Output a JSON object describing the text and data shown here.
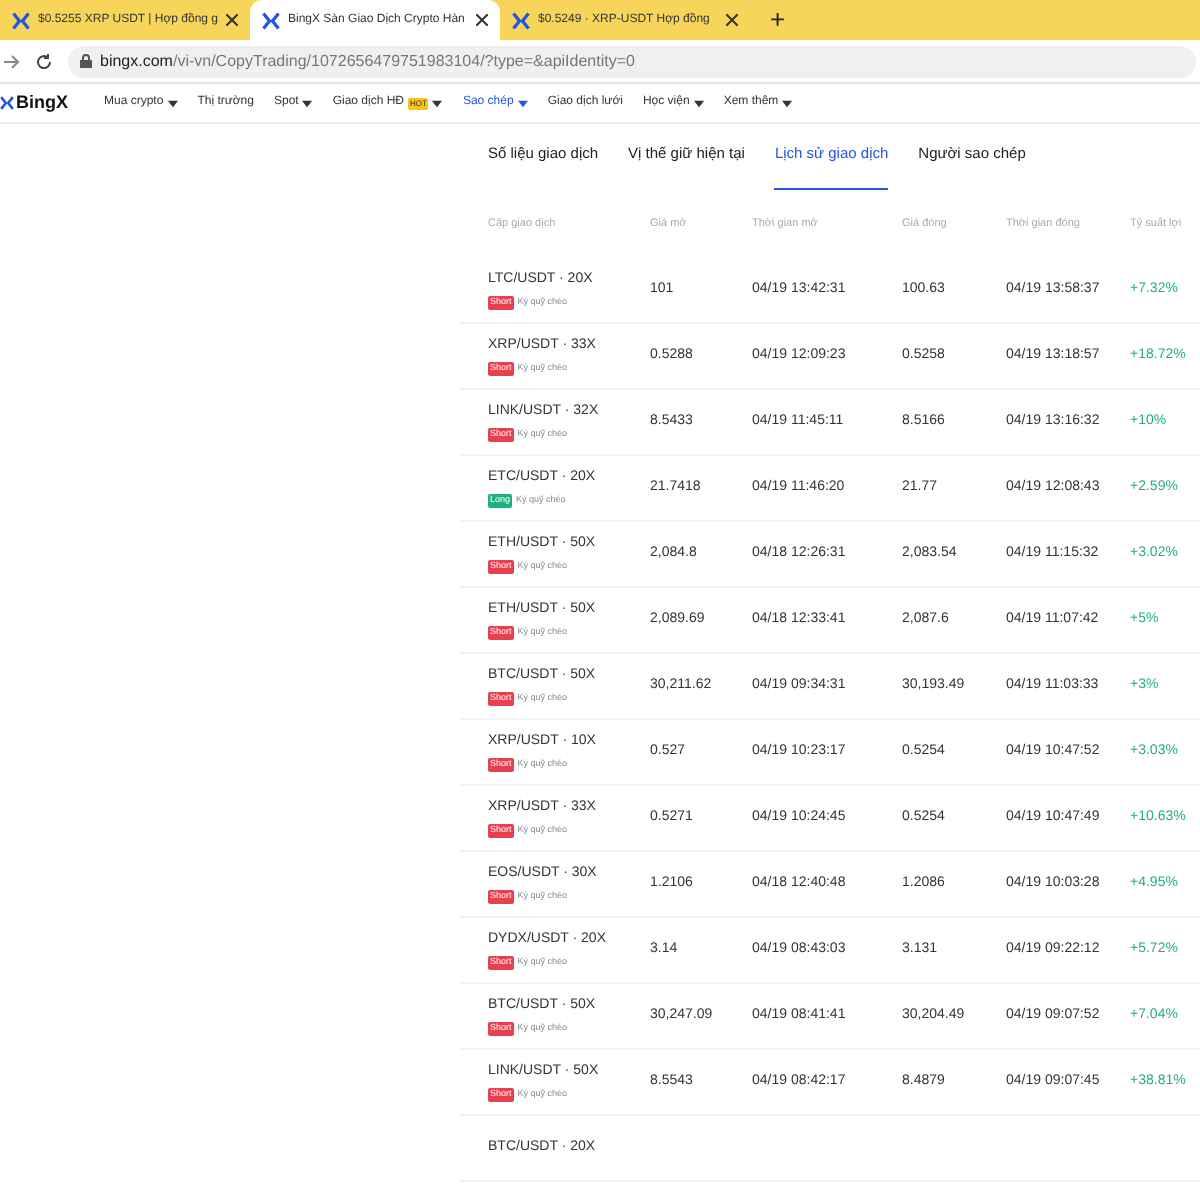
{
  "browser_tabs": [
    {
      "title": "$0.5255 XRP USDT | Hợp đồng g",
      "selected": false
    },
    {
      "title": "BingX Sàn Giao Dịch Crypto Hàn",
      "selected": true
    },
    {
      "title": "$0.5249 · XRP-USDT Hợp đồng",
      "selected": false
    }
  ],
  "new_tab": "+",
  "address_bar": {
    "domain": "bingx.com",
    "path": "/vi-vn/CopyTrading/1072656479751983104/?type=&apiIdentity=0"
  },
  "logo": "BingX",
  "nav": [
    {
      "label": "Mua crypto",
      "dropdown": true,
      "selected": false
    },
    {
      "label": "Thị trường",
      "dropdown": false,
      "selected": false
    },
    {
      "label": "Spot",
      "dropdown": true,
      "selected": false
    },
    {
      "label": "Giao dịch HĐ",
      "badge": "HOT",
      "dropdown": true,
      "selected": false
    },
    {
      "label": "Sao chép",
      "dropdown": true,
      "selected": true
    },
    {
      "label": "Giao dịch lưới",
      "dropdown": false,
      "selected": false
    },
    {
      "label": "Học viện",
      "dropdown": true,
      "selected": false
    },
    {
      "label": "Xem thêm",
      "dropdown": true,
      "selected": false
    }
  ],
  "tabs": [
    {
      "label": "Số liệu giao dịch",
      "selected": false
    },
    {
      "label": "Vị thế giữ hiện tại",
      "selected": false
    },
    {
      "label": "Lịch sử giao dịch",
      "selected": true
    },
    {
      "label": "Người sao chép",
      "selected": false
    }
  ],
  "table": {
    "columns": [
      "Cặp giao dịch",
      "Giá mở",
      "Thời gian mở",
      "Giá đóng",
      "Thời gian đóng",
      "Tỷ suất lợi"
    ],
    "rows": [
      {
        "pair": "LTC/USDT · 20X",
        "kind": "short",
        "side_label": "Short",
        "margin": "Ký quỹ chéo",
        "open_price": "101",
        "open_time": "04/19 13:42:31",
        "close_price": "100.63",
        "close_time": "04/19 13:58:37",
        "roi": "+7.32%"
      },
      {
        "pair": "XRP/USDT · 33X",
        "kind": "short",
        "side_label": "Short",
        "margin": "Ký quỹ chéo",
        "open_price": "0.5288",
        "open_time": "04/19 12:09:23",
        "close_price": "0.5258",
        "close_time": "04/19 13:18:57",
        "roi": "+18.72%"
      },
      {
        "pair": "LINK/USDT · 32X",
        "kind": "short",
        "side_label": "Short",
        "margin": "Ký quỹ chéo",
        "open_price": "8.5433",
        "open_time": "04/19 11:45:11",
        "close_price": "8.5166",
        "close_time": "04/19 13:16:32",
        "roi": "+10%"
      },
      {
        "pair": "ETC/USDT · 20X",
        "kind": "long",
        "side_label": "Long",
        "margin": "Ký quỹ chéo",
        "open_price": "21.7418",
        "open_time": "04/19 11:46:20",
        "close_price": "21.77",
        "close_time": "04/19 12:08:43",
        "roi": "+2.59%"
      },
      {
        "pair": "ETH/USDT · 50X",
        "side_label": "Short",
        "margin": "Ký quỹ chéo",
        "open_price": "2,084.8",
        "kind": "short",
        "open_time": "04/18 12:26:31",
        "close_price": "2,083.54",
        "close_time": "04/19 11:15:32",
        "roi": "+3.02%"
      },
      {
        "pair": "ETH/USDT · 50X",
        "kind": "short",
        "side_label": "Short",
        "margin": "Ký quỹ chéo",
        "open_price": "2,089.69",
        "open_time": "04/18 12:33:41",
        "close_price": "2,087.6",
        "close_time": "04/19 11:07:42",
        "roi": "+5%"
      },
      {
        "pair": "BTC/USDT · 50X",
        "kind": "short",
        "side_label": "Short",
        "margin": "Ký quỹ chéo",
        "open_price": "30,211.62",
        "open_time": "04/19 09:34:31",
        "close_price": "30,193.49",
        "close_time": "04/19 11:03:33",
        "roi": "+3%"
      },
      {
        "pair": "XRP/USDT · 10X",
        "kind": "short",
        "side_label": "Short",
        "margin": "Ký quỹ chéo",
        "open_price": "0.527",
        "open_time": "04/19 10:23:17",
        "close_price": "0.5254",
        "close_time": "04/19 10:47:52",
        "roi": "+3.03%"
      },
      {
        "pair": "XRP/USDT · 33X",
        "kind": "short",
        "side_label": "Short",
        "margin": "Ký quỹ chéo",
        "open_price": "0.5271",
        "open_time": "04/19 10:24:45",
        "close_price": "0.5254",
        "close_time": "04/19 10:47:49",
        "roi": "+10.63%"
      },
      {
        "pair": "EOS/USDT · 30X",
        "kind": "short",
        "side_label": "Short",
        "margin": "Ký quỹ chéo",
        "open_price": "1.2106",
        "open_time": "04/18 12:40:48",
        "close_price": "1.2086",
        "close_time": "04/19 10:03:28",
        "roi": "+4.95%"
      },
      {
        "pair": "DYDX/USDT · 20X",
        "kind": "short",
        "side_label": "Short",
        "margin": "Ký quỹ chéo",
        "open_price": "3.14",
        "open_time": "04/19 08:43:03",
        "close_price": "3.131",
        "close_time": "04/19 09:22:12",
        "roi": "+5.72%"
      },
      {
        "pair": "BTC/USDT · 50X",
        "kind": "short",
        "side_label": "Short",
        "margin": "Ký quỹ chéo",
        "open_price": "30,247.09",
        "open_time": "04/19 08:41:41",
        "close_price": "30,204.49",
        "close_time": "04/19 09:07:52",
        "roi": "+7.04%"
      },
      {
        "pair": "LINK/USDT · 50X",
        "kind": "short",
        "side_label": "Short",
        "margin": "Ký quỹ chéo",
        "open_price": "8.5543",
        "open_time": "04/19 08:42:17",
        "close_price": "8.4879",
        "close_time": "04/19 09:07:45",
        "roi": "+38.81%"
      },
      {
        "pair": "BTC/USDT · 20X"
      }
    ]
  }
}
